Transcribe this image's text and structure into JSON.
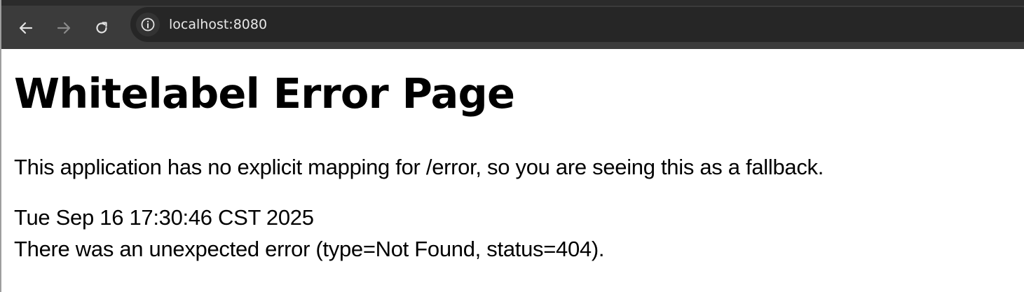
{
  "browser": {
    "url": "localhost:8080",
    "icons": {
      "back": "arrow-left-icon",
      "forward": "arrow-right-icon",
      "reload": "reload-icon",
      "site_info": "info-icon"
    },
    "colors": {
      "toolbar": "#3b3b3b",
      "omnibox": "#262626",
      "forward_disabled": "#8a8a8a"
    }
  },
  "page": {
    "title": "Whitelabel Error Page",
    "explanation": "This application has no explicit mapping for /error, so you are seeing this as a fallback.",
    "timestamp": "Tue Sep 16 17:30:46 CST 2025",
    "error_message": "There was an unexpected error (type=Not Found, status=404)."
  }
}
